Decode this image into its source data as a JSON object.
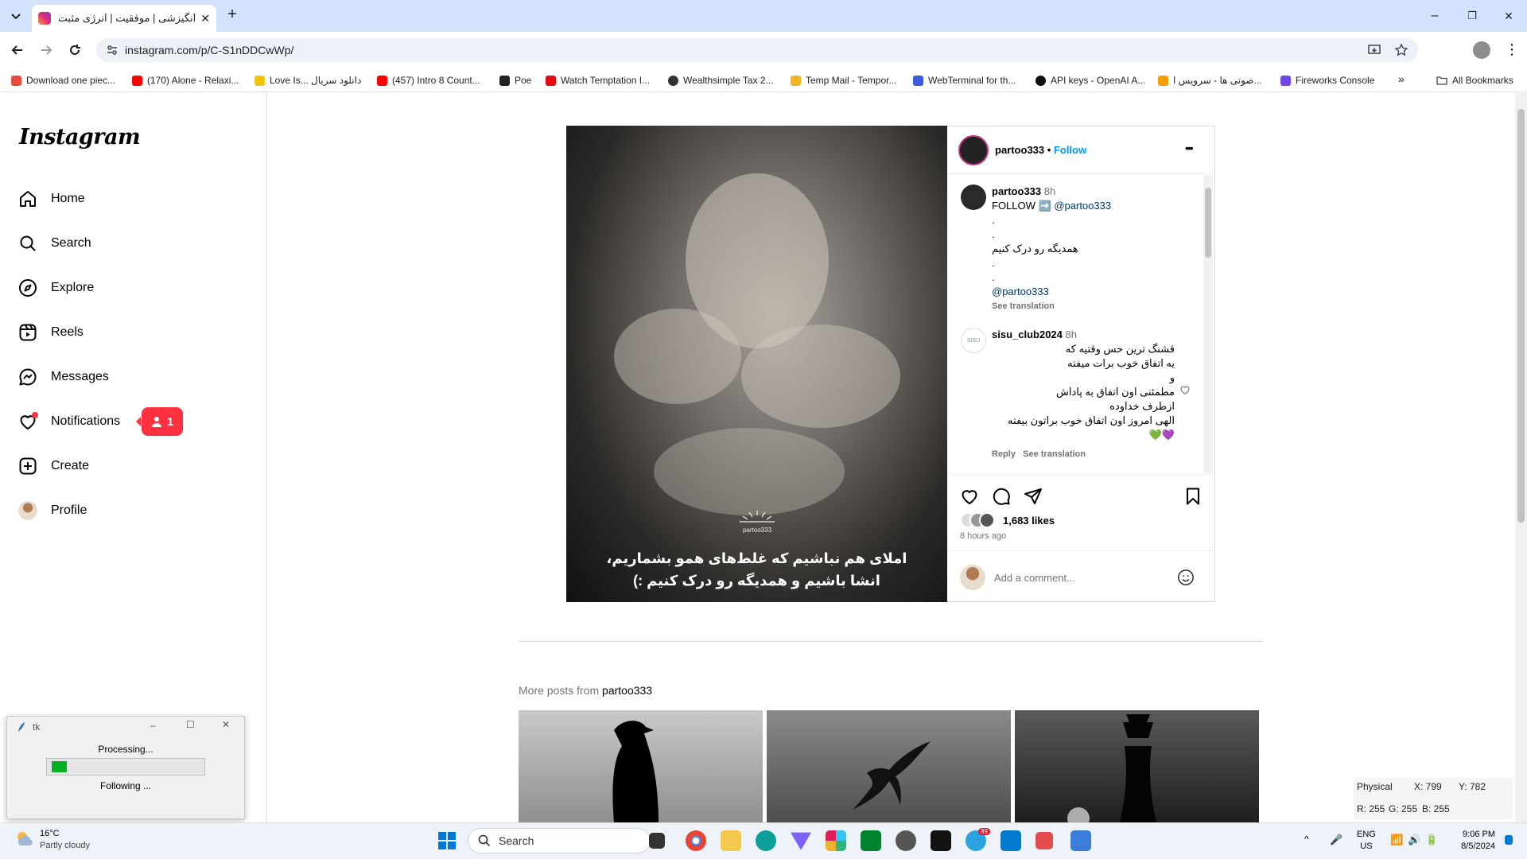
{
  "browser": {
    "tab_title": "انگیزشی | موفقیت | انرژی مثبت |",
    "new_tab": "+",
    "url": "instagram.com/p/C-S1nDDCwWp/",
    "window_controls": {
      "minimize": "–",
      "restore": "❐",
      "close": "✕"
    },
    "bookmarks": [
      {
        "label": "Download one piec...",
        "color": "#e74c3c"
      },
      {
        "label": "(170) Alone - Relaxi...",
        "color": "#ff0000"
      },
      {
        "label": "Love Is... دانلود سریال",
        "color": "#f1c40f"
      },
      {
        "label": "(457) Intro 8 Count...",
        "color": "#ff0000"
      },
      {
        "label": "Poe",
        "color": "#222222"
      },
      {
        "label": "Watch Temptation I...",
        "color": "#e50914"
      },
      {
        "label": "Wealthsimple Tax 2...",
        "color": "#333333"
      },
      {
        "label": "Temp Mail - Tempor...",
        "color": "#f0b429"
      },
      {
        "label": "WebTerminal for th...",
        "color": "#3b5bdb"
      },
      {
        "label": "API keys - OpenAI A...",
        "color": "#111111"
      },
      {
        "label": "صوتی ها - سرویس ا...",
        "color": "#f59f00"
      },
      {
        "label": "Fireworks Console",
        "color": "#7048e8"
      }
    ],
    "all_bookmarks": "All Bookmarks"
  },
  "sidebar": {
    "logo": "Instagram",
    "items": [
      {
        "label": "Home",
        "icon": "home-icon"
      },
      {
        "label": "Search",
        "icon": "search-icon"
      },
      {
        "label": "Explore",
        "icon": "explore-icon"
      },
      {
        "label": "Reels",
        "icon": "reels-icon"
      },
      {
        "label": "Messages",
        "icon": "messages-icon"
      },
      {
        "label": "Notifications",
        "icon": "heart-icon"
      },
      {
        "label": "Create",
        "icon": "plus-square-icon"
      },
      {
        "label": "Profile",
        "icon": "avatar"
      }
    ],
    "notification_count": "1"
  },
  "post": {
    "caption_line1": "املای هم نباشیم که غلط‌های همو بشماریم،",
    "caption_line2": "انشا باشیم و همدیگه رو درک کنیم :)",
    "watermark": "partoo333",
    "author": "partoo333",
    "follow": "Follow",
    "more": "•••",
    "desc": {
      "user": "partoo333",
      "time": "8h",
      "line1_prefix": "FOLLOW ➡️",
      "line1_mention": "@partoo333",
      "dot": ".",
      "persian": "همدیگه رو درک کنیم",
      "mention": "@partoo333",
      "see_translation": "See translation"
    },
    "comment": {
      "user": "sisu_club2024",
      "time": "8h",
      "avatar_text": "SISU",
      "lines": [
        "قشنگ ترین حس وقتیه که",
        "یه اتفاق خوب برات میفته",
        "و",
        "مطمئنی اون اتفاق به پاداش",
        "ازطرف خداوده",
        "الهی امروز اون اتفاق خوب براتون بیفته",
        "💜💚"
      ],
      "reply": "Reply",
      "see_translation": "See translation"
    },
    "likes": "1,683 likes",
    "time_ago": "8 hours ago",
    "add_comment_placeholder": "Add a comment..."
  },
  "more_posts": {
    "prefix": "More posts from",
    "user": "partoo333"
  },
  "tk_window": {
    "title": "tk",
    "processing": "Processing...",
    "progress": 0.1,
    "following": "Following ..."
  },
  "pixel_info": {
    "mode": "Physical",
    "x": "X: 799",
    "y": "Y: 782",
    "r": "R: 255",
    "g": "G: 255",
    "b": "B: 255"
  },
  "taskbar": {
    "temp": "16°C",
    "weather": "Partly cloudy",
    "search": "Search",
    "lang1": "ENG",
    "lang2": "US",
    "time": "9:06 PM",
    "date": "8/5/2024",
    "telegram_badge": "89"
  }
}
